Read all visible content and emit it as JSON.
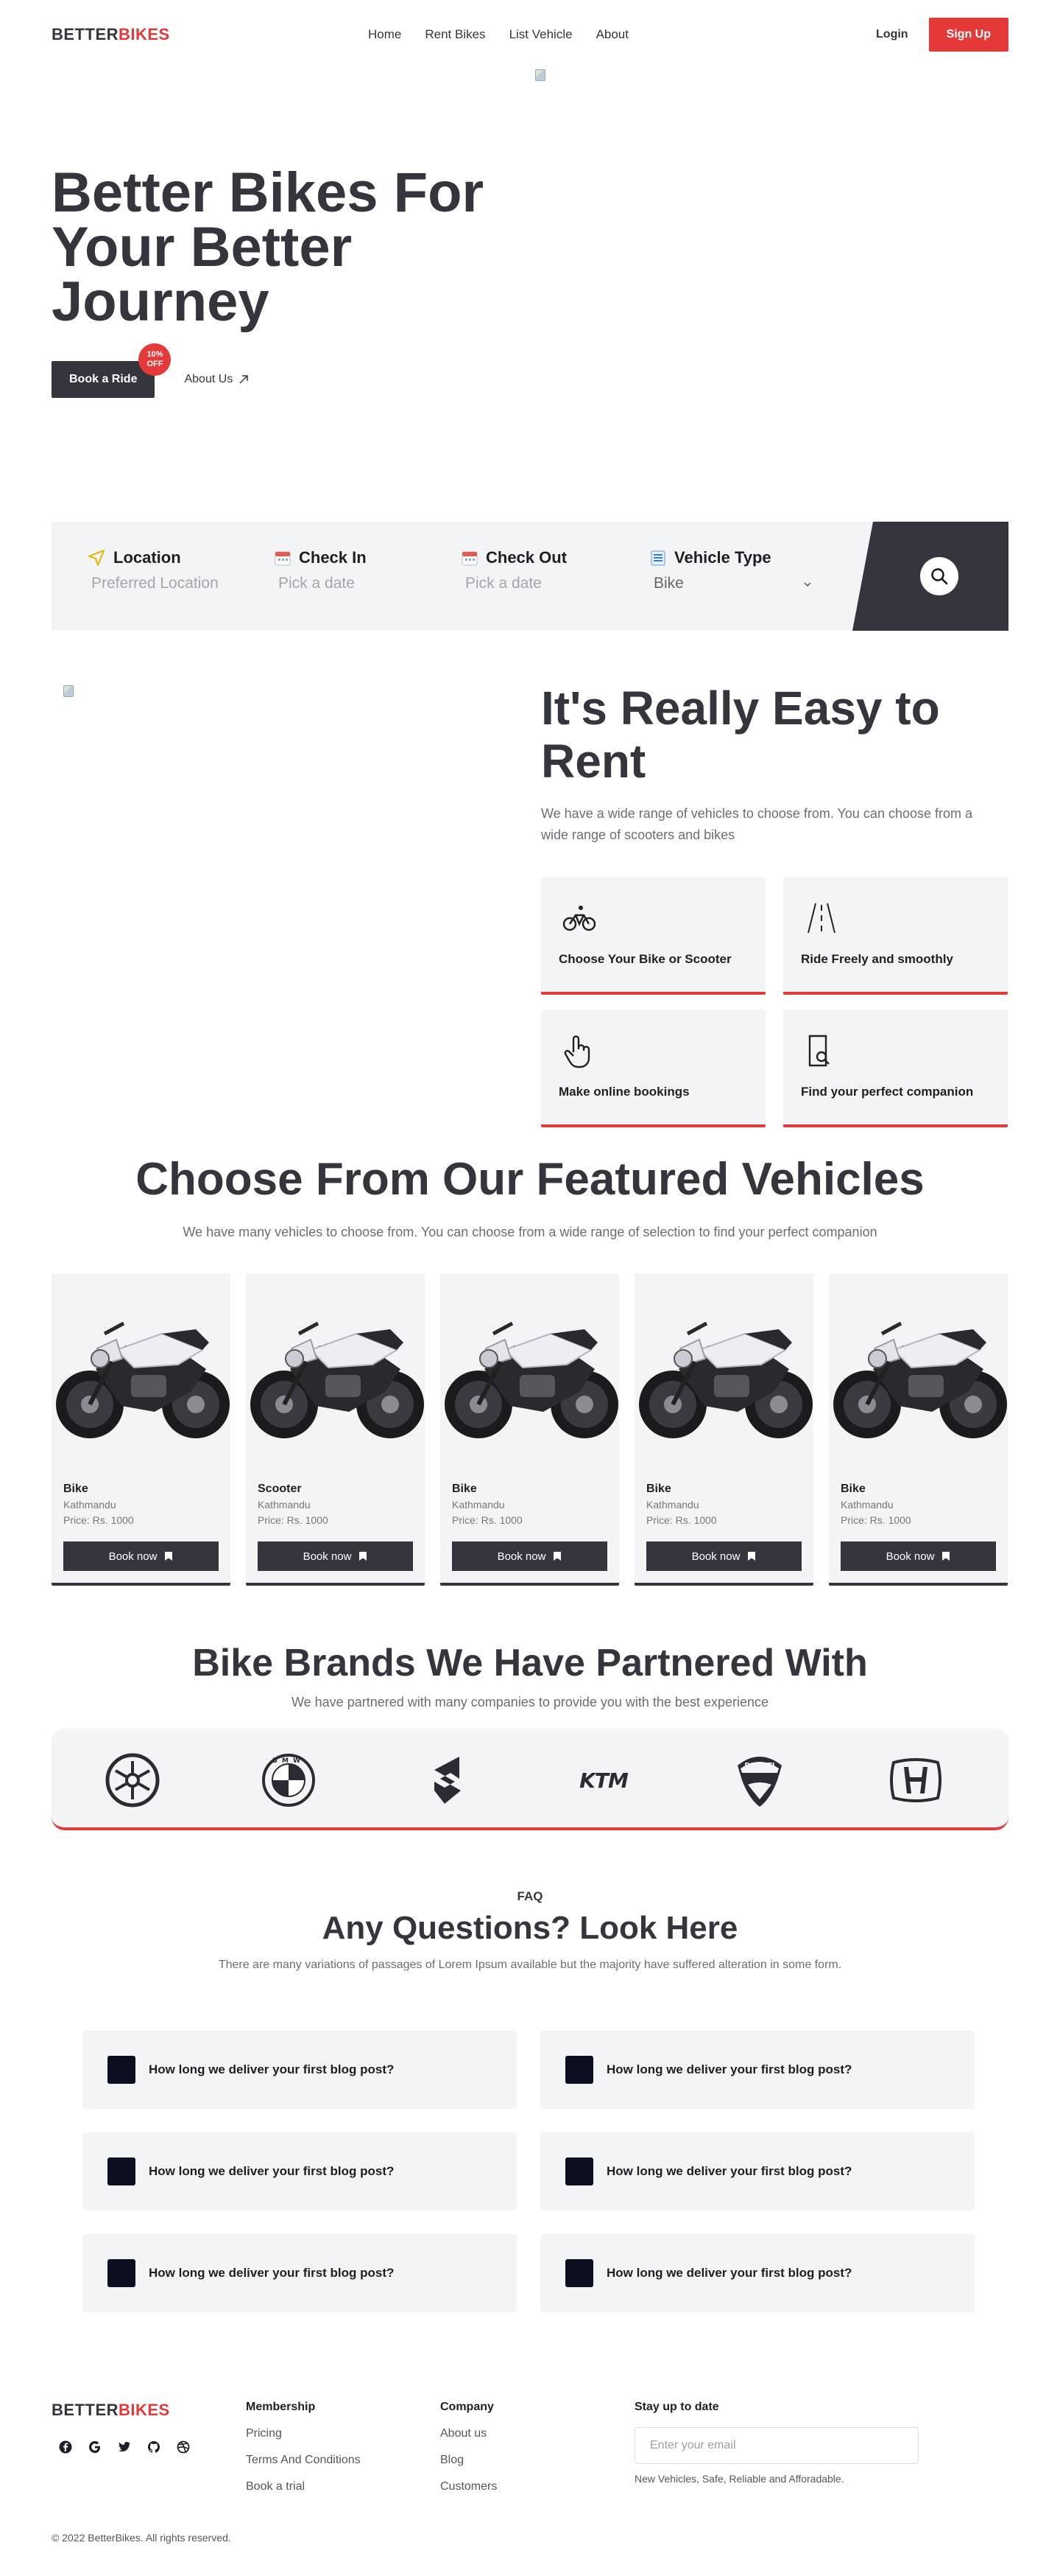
{
  "brand": {
    "logo_main": "BETTER",
    "logo_accent": "BIKES"
  },
  "nav": {
    "links": [
      "Home",
      "Rent Bikes",
      "List Vehicle",
      "About"
    ],
    "login": "Login",
    "signup": "Sign Up"
  },
  "hero": {
    "title_line1": "Better Bikes For",
    "title_line2": "Your Better",
    "title_line3": "Journey",
    "cta": "Book a Ride",
    "badge_line1": "10%",
    "badge_line2": "OFF",
    "about": "About Us"
  },
  "search": {
    "location_label": "Location",
    "location_placeholder": "Preferred Location",
    "checkin_label": "Check In",
    "checkin_placeholder": "Pick a date",
    "checkout_label": "Check Out",
    "checkout_placeholder": "Pick a date",
    "vehicle_label": "Vehicle Type",
    "vehicle_value": "Bike"
  },
  "easy": {
    "title_line1": "It's Really Easy to",
    "title_line2": "Rent",
    "text": "We have a wide range of vehicles to choose from. You can choose from a wide range of scooters and bikes",
    "features": [
      {
        "label": "Choose Your Bike or Scooter",
        "icon": "bicycle-icon"
      },
      {
        "label": "Ride Freely and smoothly",
        "icon": "road-icon"
      },
      {
        "label": "Make online bookings",
        "icon": "pointer-hand-icon"
      },
      {
        "label": "Find your perfect companion",
        "icon": "search-document-icon"
      }
    ]
  },
  "featured": {
    "title": "Choose From Our Featured Vehicles",
    "subtitle": "We have many vehicles to choose from. You can choose from a wide range of selection to find your perfect companion",
    "vehicles": [
      {
        "type": "Bike",
        "location": "Kathmandu",
        "price": "Price: Rs. 1000",
        "button": "Book now"
      },
      {
        "type": "Scooter",
        "location": "Kathmandu",
        "price": "Price: Rs. 1000",
        "button": "Book now"
      },
      {
        "type": "Bike",
        "location": "Kathmandu",
        "price": "Price: Rs. 1000",
        "button": "Book now"
      },
      {
        "type": "Bike",
        "location": "Kathmandu",
        "price": "Price: Rs. 1000",
        "button": "Book now"
      },
      {
        "type": "Bike",
        "location": "Kathmandu",
        "price": "Price: Rs. 1000",
        "button": "Book now"
      }
    ]
  },
  "brands": {
    "title": "Bike Brands We Have Partnered With",
    "subtitle": "We have partnered with many companies to provide you with the best experience",
    "logos": [
      "yamaha-logo",
      "bmw-logo",
      "suzuki-logo",
      "ktm-logo",
      "ducati-logo",
      "honda-logo"
    ],
    "ktm_text": "KTM",
    "ducati_text": "DUCATI",
    "bmw_letters": "BMW"
  },
  "faq": {
    "eyebrow": "FAQ",
    "title": "Any Questions? Look Here",
    "subtitle": "There are many variations of passages of Lorem Ipsum available but the majority have suffered alteration in some form.",
    "questions": [
      "How long we deliver your first blog post?",
      "How long we deliver your first blog post?",
      "How long we deliver your first blog post?",
      "How long we deliver your first blog post?",
      "How long we deliver your first blog post?",
      "How long we deliver your first blog post?"
    ]
  },
  "footer": {
    "membership_title": "Membership",
    "membership_links": [
      "Pricing",
      "Terms And Conditions",
      "Book a trial"
    ],
    "company_title": "Company",
    "company_links": [
      "About us",
      "Blog",
      "Customers"
    ],
    "newsletter_title": "Stay up to date",
    "email_placeholder": "Enter your email",
    "newsletter_note": "New Vehicles, Safe, Reliable and Afforadable.",
    "copyright": "© 2022 BetterBikes. All rights reserved.",
    "socials": [
      "facebook-icon",
      "google-icon",
      "twitter-icon",
      "github-icon",
      "dribbble-icon"
    ]
  },
  "colors": {
    "accent": "#e53939",
    "dark": "#35363d",
    "panel": "#f3f4f6"
  }
}
